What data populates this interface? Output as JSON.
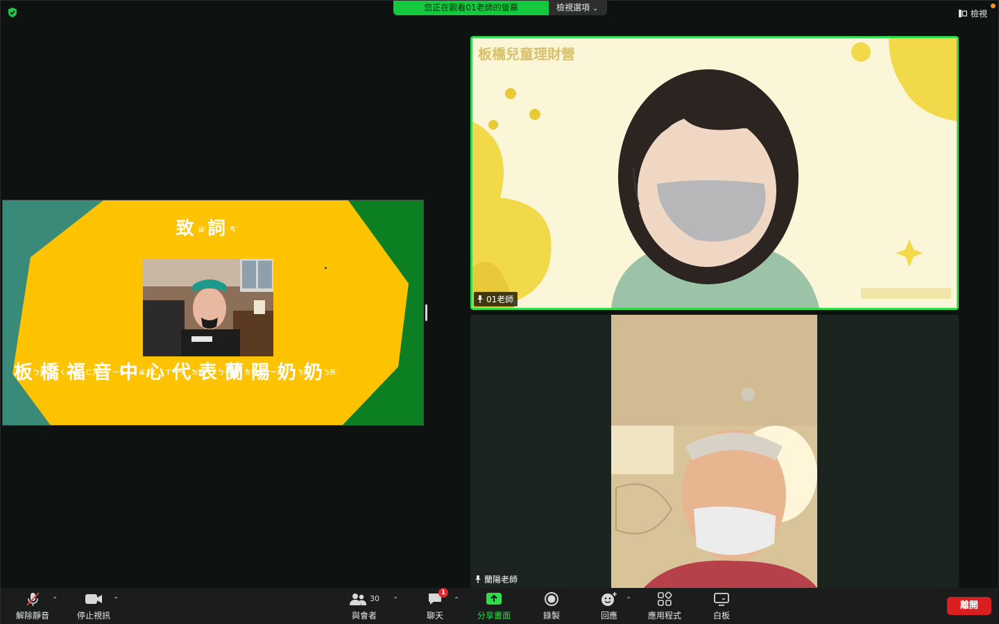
{
  "top_bar": {
    "banner_text": "您正在觀看01老師的螢幕",
    "view_options_label": "檢視選項",
    "view_label": "檢視"
  },
  "shared_slide": {
    "title_chars": [
      {
        "char": "致",
        "zhuyin": "ㄓˋ"
      },
      {
        "char": "詞",
        "zhuyin": "ㄘˊ"
      }
    ],
    "name_chars": [
      {
        "char": "板",
        "zhuyin": "ㄅㄢˇ"
      },
      {
        "char": "橋",
        "zhuyin": "ㄑㄧㄠˊ"
      },
      {
        "char": "福",
        "zhuyin": "ㄈㄨˊ"
      },
      {
        "char": "音",
        "zhuyin": "ㄧㄣ"
      },
      {
        "char": "中",
        "zhuyin": "ㄓㄨㄥ"
      },
      {
        "char": "心",
        "zhuyin": "ㄒㄧㄣ"
      },
      {
        "char": "代",
        "zhuyin": "ㄉㄞˋ"
      },
      {
        "char": "表",
        "zhuyin": "ㄅㄧㄠˇ"
      },
      {
        "char": "蘭",
        "zhuyin": "ㄌㄢˊ"
      },
      {
        "char": "陽",
        "zhuyin": "ㄧㄤˊ"
      },
      {
        "char": "奶",
        "zhuyin": "ㄋㄞˇ"
      },
      {
        "char": "奶",
        "zhuyin": "ㄋㄞ˙"
      }
    ]
  },
  "videos": [
    {
      "name": "01老師",
      "background_title": "板橋兒童理財營",
      "active_speaker": true
    },
    {
      "name": "蘭陽老師",
      "active_speaker": false
    }
  ],
  "toolbar": {
    "unmute_label": "解除靜音",
    "stop_video_label": "停止視訊",
    "participants_label": "與會者",
    "participants_count": "30",
    "chat_label": "聊天",
    "chat_badge": "1",
    "share_label": "分享畫面",
    "record_label": "錄製",
    "reactions_label": "回應",
    "apps_label": "應用程式",
    "whiteboard_label": "白板",
    "leave_label": "離開"
  },
  "colors": {
    "speaker_border": "#2fdc4a",
    "banner": "#14c93e",
    "leave": "#d81e1e",
    "slide_yellow": "#fdc300",
    "slide_green": "#0b7f22",
    "slide_teal": "#3a8a7a"
  }
}
